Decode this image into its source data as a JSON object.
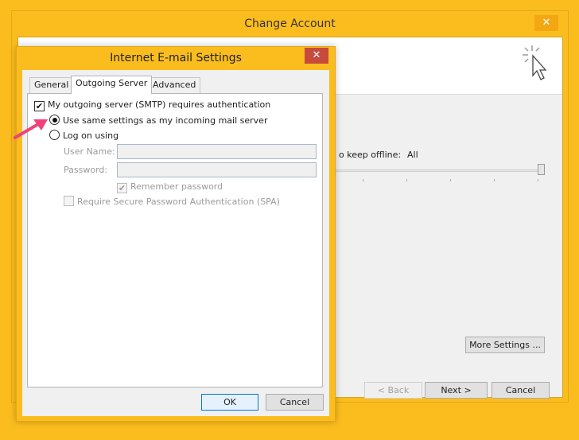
{
  "back_window": {
    "title": "Change Account",
    "close_glyph": "✕",
    "offline_label": "o keep offline:",
    "offline_value": "All",
    "buttons": {
      "more_settings": "More Settings ...",
      "back": "< Back",
      "next": "Next >",
      "cancel": "Cancel"
    }
  },
  "dialog": {
    "title": "Internet E-mail Settings",
    "close_glyph": "✕",
    "tabs": [
      {
        "label": "General",
        "active": false
      },
      {
        "label": "Outgoing Server",
        "active": true
      },
      {
        "label": "Advanced",
        "active": false
      }
    ],
    "smtp_auth": {
      "label": "My outgoing server (SMTP) requires authentication",
      "checked": true
    },
    "options": {
      "same_settings": {
        "label": "Use same settings as my incoming mail server",
        "selected": true
      },
      "log_on": {
        "label": "Log on using",
        "selected": false
      }
    },
    "user_name": {
      "label": "User Name:",
      "value": ""
    },
    "password": {
      "label": "Password:",
      "value": ""
    },
    "remember_password": {
      "label": "Remember password",
      "checked": true
    },
    "spa": {
      "label": "Require Secure Password Authentication (SPA)",
      "checked": false
    },
    "buttons": {
      "ok": "OK",
      "cancel": "Cancel"
    }
  },
  "colors": {
    "background": "#fbbd1e",
    "annotation_arrow": "#f0427a",
    "close_button": "#c74a3c"
  },
  "icons": {
    "check": "✔",
    "arrow": "annotation-arrow"
  }
}
